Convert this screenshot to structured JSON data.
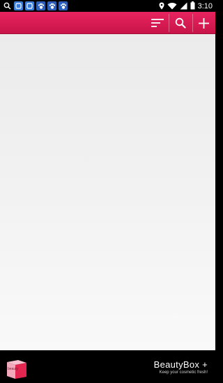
{
  "status_bar": {
    "time": "3:10",
    "notification_icons": [
      "search-icon",
      "app-icon",
      "app-icon",
      "paw-icon",
      "paw-icon",
      "paw-icon"
    ],
    "system_icons": [
      "location-icon",
      "wifi-icon",
      "signal-icon",
      "battery-icon"
    ]
  },
  "app_bar": {
    "accent_color": "#d81b55",
    "actions": [
      "sort-icon",
      "search-icon",
      "add-icon"
    ]
  },
  "banner": {
    "title": "BeautyBox +",
    "tagline": "Keep your cosmetic fresh!",
    "logo_text": "beauty"
  },
  "colors": {
    "content_bg_top": "#ebebeb",
    "content_bg_bottom": "#f9f9f9",
    "banner_bg": "#000000"
  }
}
